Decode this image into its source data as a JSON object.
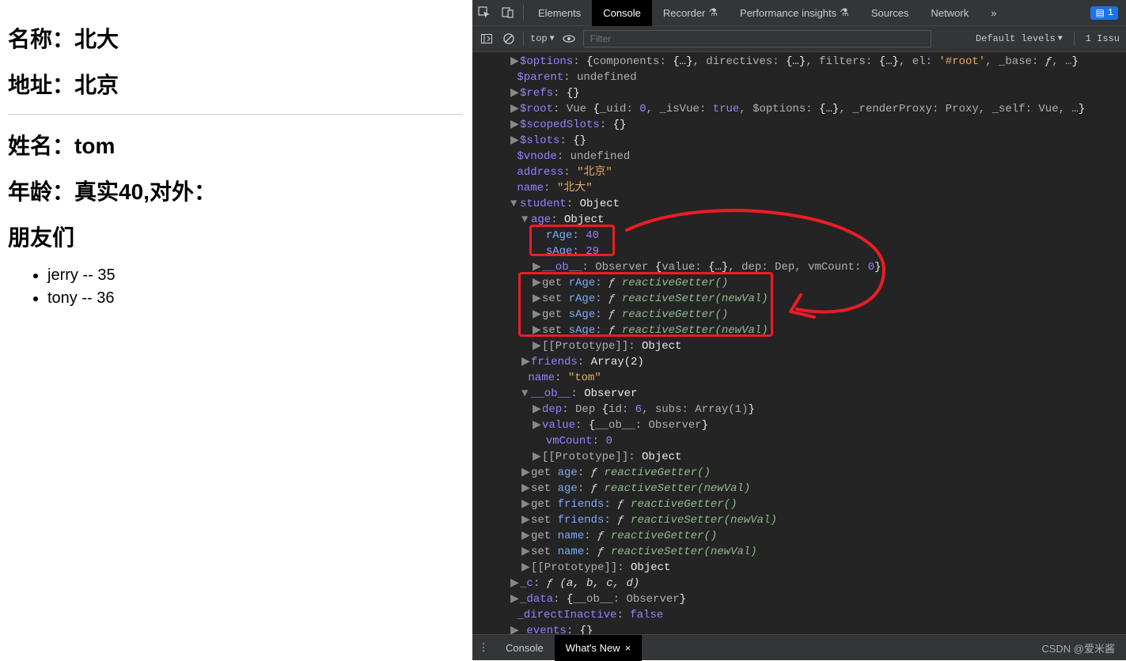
{
  "page": {
    "name_label": "名称：",
    "name_value": "北大",
    "addr_label": "地址：",
    "addr_value": "北京",
    "sname_label": "姓名：",
    "sname_value": "tom",
    "age_label": "年龄：",
    "age_value": "真实40,对外：",
    "friends_label": "朋友们",
    "friends": [
      "jerry -- 35",
      "tony -- 36"
    ]
  },
  "devtools": {
    "tabs": {
      "elements": "Elements",
      "console": "Console",
      "recorder": "Recorder",
      "perf": "Performance insights",
      "sources": "Sources",
      "network": "Network"
    },
    "issues_count": "1",
    "toolbar": {
      "context": "top",
      "filter_placeholder": "Filter",
      "levels": "Default levels",
      "issue_text": "1 Issu"
    },
    "bottom": {
      "console": "Console",
      "whatsnew": "What's New",
      "watermark": "CSDN @爱米酱"
    }
  },
  "console": {
    "l1_prefix": "▶",
    "l1": "$options: {components: {…}, directives: {…}, filters: {…}, el: '#root', _base: ƒ, …}",
    "l2": "$parent: undefined",
    "l3": "▶ $refs: {}",
    "l4": "▶ $root: Vue {_uid: 0, _isVue: true, $options: {…}, _renderProxy: Proxy, _self: Vue, …}",
    "l5": "▶ $scopedSlots: {}",
    "l6": "▶ $slots: {}",
    "l7": "$vnode: undefined",
    "l8": "address: \"北京\"",
    "l9": "name: \"北大\"",
    "l10": "▼ student: Object",
    "l11": "▼ age: Object",
    "l12": "rAge: 40",
    "l13": "sAge: 29",
    "l14": "▶ __ob__: Observer {value: {…}, dep: Dep, vmCount: 0}",
    "l15": "▶ get rAge: ƒ reactiveGetter()",
    "l16": "▶ set rAge: ƒ reactiveSetter(newVal)",
    "l17": "▶ get sAge: ƒ reactiveGetter()",
    "l18": "▶ set sAge: ƒ reactiveSetter(newVal)",
    "l19": "▶ [[Prototype]]: Object",
    "l20": "▶ friends: Array(2)",
    "l21": "name: \"tom\"",
    "l22": "▼ __ob__: Observer",
    "l23": "▶ dep: Dep {id: 6, subs: Array(1)}",
    "l24": "▶ value: {__ob__: Observer}",
    "l25": "vmCount: 0",
    "l26": "▶ [[Prototype]]: Object",
    "l27": "▶ get age: ƒ reactiveGetter()",
    "l28": "▶ set age: ƒ reactiveSetter(newVal)",
    "l29": "▶ get friends: ƒ reactiveGetter()",
    "l30": "▶ set friends: ƒ reactiveSetter(newVal)",
    "l31": "▶ get name: ƒ reactiveGetter()",
    "l32": "▶ set name: ƒ reactiveSetter(newVal)",
    "l33": "▶ [[Prototype]]: Object",
    "l34": "▶ _c: ƒ (a, b, c, d)",
    "l35": "▶ _data: {__ob__: Observer}",
    "l36": "_directInactive: false",
    "l37": "▶ _events: {}"
  }
}
